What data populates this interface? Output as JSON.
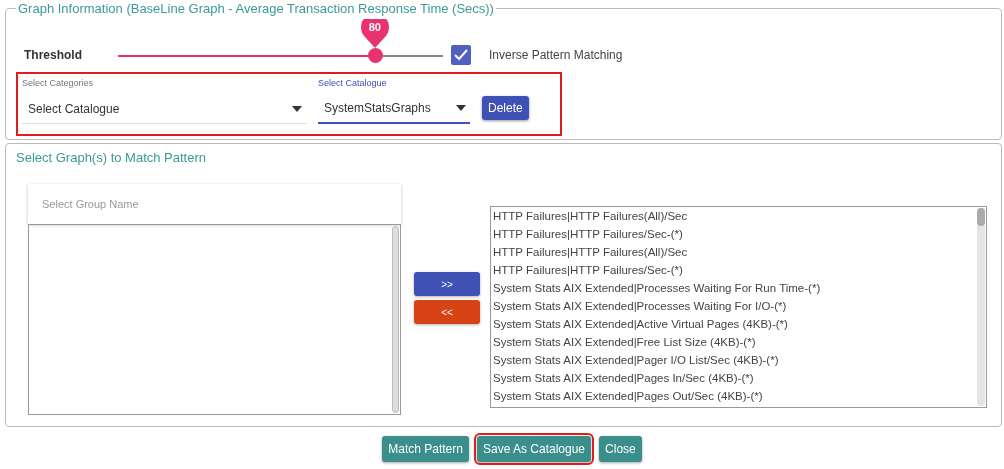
{
  "graph_info": {
    "title": "Graph Information (BaseLine Graph - Average Transaction Response Time (Secs))",
    "threshold": {
      "label": "Threshold",
      "level": 0.79,
      "reading": "80"
    },
    "inverse": {
      "label": "Inverse Pattern Matching",
      "checked": true
    },
    "selectors": {
      "highlighted": true,
      "fields": [
        {
          "label": "Select Categories",
          "value": "Select Catalogue",
          "focused": false
        },
        {
          "label": "Select Catalogue",
          "value": "SystemStatsGraphs",
          "focused": true
        }
      ],
      "delete_button": "Delete"
    }
  },
  "graph_select": {
    "title": "Select Graph(s) to Match Pattern",
    "group_placeholder": "Select Group Name",
    "move_buttons": [
      {
        "label": ">>",
        "kind": "add"
      },
      {
        "label": "<<",
        "kind": "remove"
      }
    ],
    "graphs": [
      "HTTP Failures|HTTP Failures(All)/Sec",
      "HTTP Failures|HTTP Failures/Sec-(*)",
      "HTTP Failures|HTTP Failures(All)/Sec",
      "HTTP Failures|HTTP Failures/Sec-(*)",
      "System Stats AIX Extended|Processes Waiting For Run Time-(*)",
      "System Stats AIX Extended|Processes Waiting For I/O-(*)",
      "System Stats AIX Extended|Active Virtual Pages (4KB)-(*)",
      "System Stats AIX Extended|Free List Size (4KB)-(*)",
      "System Stats AIX Extended|Pager I/O List/Sec (4KB)-(*)",
      "System Stats AIX Extended|Pages In/Sec (4KB)-(*)",
      "System Stats AIX Extended|Pages Out/Sec (4KB)-(*)"
    ]
  },
  "footer_buttons": [
    {
      "label": "Match Pattern",
      "highlighted": false
    },
    {
      "label": "Save As Catalogue",
      "highlighted": true
    },
    {
      "label": "Close",
      "highlighted": false
    }
  ]
}
